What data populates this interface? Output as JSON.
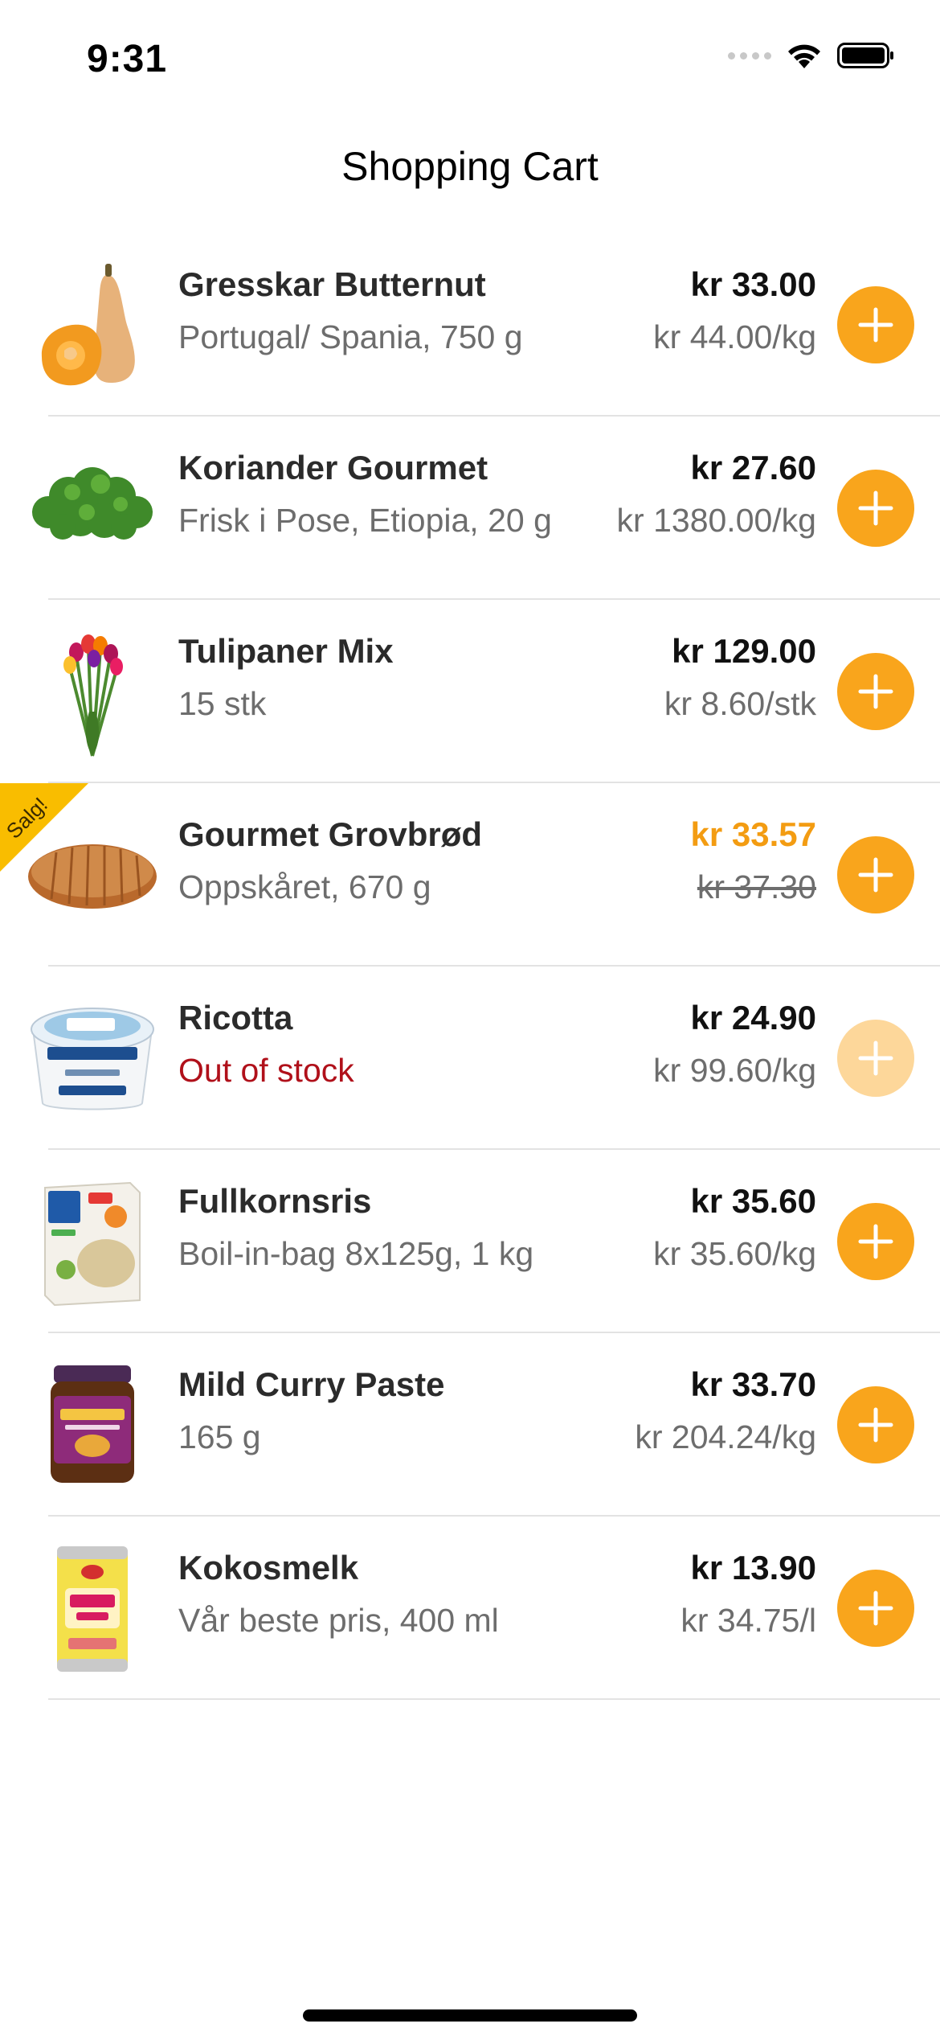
{
  "status_bar": {
    "time": "9:31"
  },
  "header": {
    "title": "Shopping Cart"
  },
  "cart": {
    "items": [
      {
        "name": "Gresskar Butternut",
        "subtitle": "Portugal/ Spania, 750 g",
        "price": "kr 33.00",
        "unit_price": "kr 44.00/kg",
        "image": "butternut-squash"
      },
      {
        "name": "Koriander Gourmet",
        "subtitle": "Frisk i Pose, Etiopia, 20 g",
        "price": "kr 27.60",
        "unit_price": "kr 1380.00/kg",
        "image": "coriander"
      },
      {
        "name": "Tulipaner Mix",
        "subtitle": "15 stk",
        "price": "kr 129.00",
        "unit_price": "kr 8.60/stk",
        "image": "tulips"
      },
      {
        "name": "Gourmet Grovbrød",
        "subtitle": "Oppskåret, 670 g",
        "price": "kr 33.57",
        "unit_price": "kr 37.30",
        "badge": "Salg!",
        "image": "bread"
      },
      {
        "name": "Ricotta",
        "subtitle": "Out of stock",
        "price": "kr 24.90",
        "unit_price": "kr 99.60/kg",
        "image": "ricotta"
      },
      {
        "name": "Fullkornsris",
        "subtitle": "Boil-in-bag 8x125g, 1 kg",
        "price": "kr 35.60",
        "unit_price": "kr 35.60/kg",
        "image": "rice-box"
      },
      {
        "name": "Mild Curry Paste",
        "subtitle": "165 g",
        "price": "kr 33.70",
        "unit_price": "kr 204.24/kg",
        "image": "curry-jar"
      },
      {
        "name": "Kokosmelk",
        "subtitle": "Vår beste pris, 400 ml",
        "price": "kr 13.90",
        "unit_price": "kr 34.75/l",
        "image": "coconut-milk-can"
      }
    ]
  },
  "colors": {
    "accent": "#f9a51c",
    "accent_disabled": "#fdd79a",
    "sale": "#f39c12",
    "out_of_stock": "#b0101a",
    "ribbon": "#f9bd00"
  }
}
